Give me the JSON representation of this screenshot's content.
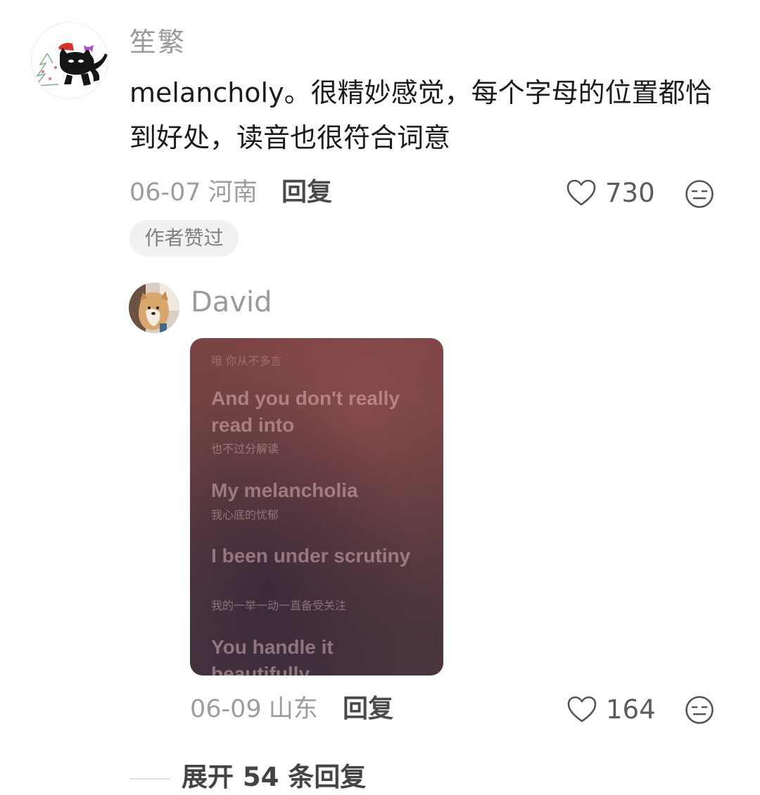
{
  "comment": {
    "username": "笙繁",
    "text": "melancholy。很精妙感觉，每个字母的位置都恰到好处，读音也很符合词意",
    "date": "06-07",
    "region": "河南",
    "reply_label": "回复",
    "likes": "730",
    "author_badge": "作者赞过"
  },
  "reply": {
    "username": "David",
    "lyrics": {
      "top": "哦 你从不多言",
      "lines": [
        {
          "en": "And you don't really read into",
          "cn": "也不过分解读"
        },
        {
          "en": "My melancholia",
          "cn": "我心底的忧郁"
        },
        {
          "en": "I been under scrutiny",
          "cn": "我的一举一动一直备受关注"
        },
        {
          "en": "You handle it beautifully",
          "cn": ""
        }
      ]
    },
    "date": "06-09",
    "region": "山东",
    "reply_label": "回复",
    "likes": "164"
  },
  "expand": {
    "label": "展开 54 条回复"
  },
  "icons": {
    "like": "heart-outline-icon",
    "dislike": "meh-face-icon"
  },
  "colors": {
    "username": "#9a9a9a",
    "meta": "#9d9d9d",
    "badge_bg": "#f1f1f1"
  }
}
